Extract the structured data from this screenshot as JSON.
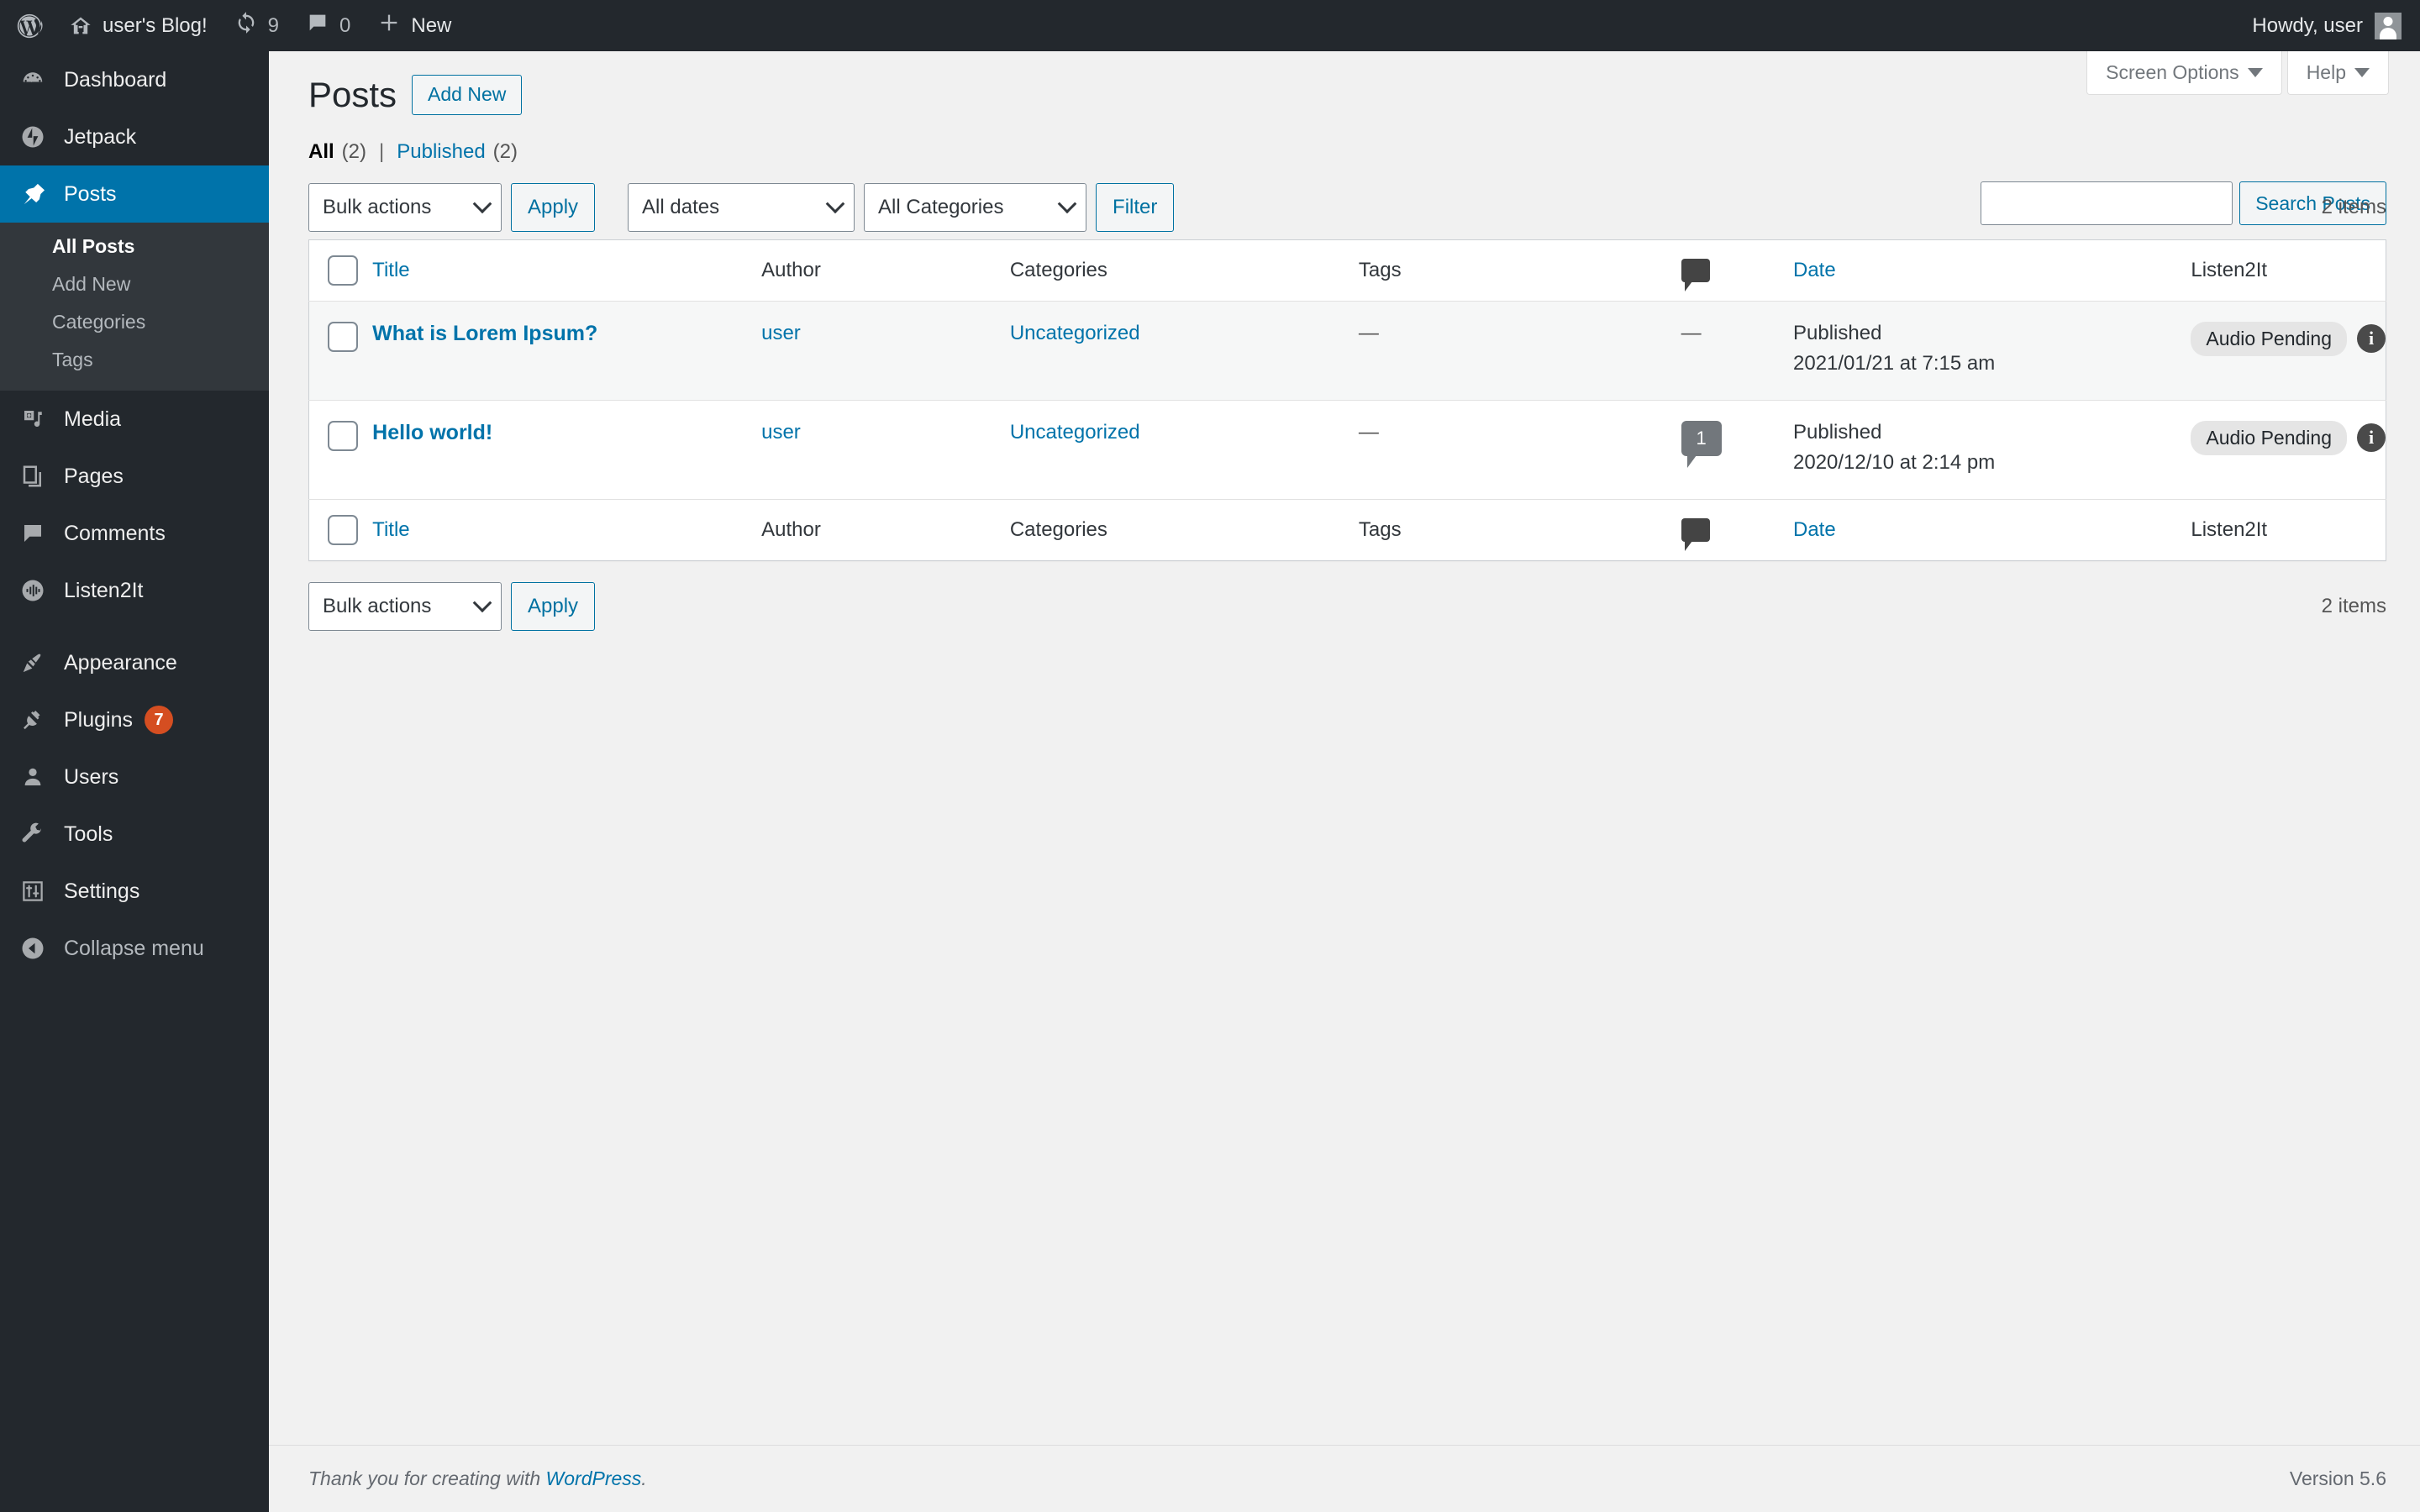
{
  "adminbar": {
    "logo_icon": "wordpress-logo-icon",
    "home_icon": "home-icon",
    "site_name": "user's Blog!",
    "updates_icon": "updates-icon",
    "updates_count": "9",
    "comments_icon": "comment-icon",
    "comments_count": "0",
    "new_icon": "plus-icon",
    "new_label": "New",
    "howdy": "Howdy, user",
    "avatar_icon": "avatar"
  },
  "sidebar": {
    "items": [
      {
        "label": "Dashboard",
        "icon": "dashboard-icon",
        "active": false
      },
      {
        "label": "Jetpack",
        "icon": "jetpack-icon",
        "active": false
      },
      {
        "label": "Posts",
        "icon": "pin-icon",
        "active": true
      },
      {
        "label": "Media",
        "icon": "media-icon",
        "active": false
      },
      {
        "label": "Pages",
        "icon": "pages-icon",
        "active": false
      },
      {
        "label": "Comments",
        "icon": "comments-icon",
        "active": false
      },
      {
        "label": "Listen2It",
        "icon": "listen2it-icon",
        "active": false
      },
      {
        "label": "Appearance",
        "icon": "appearance-icon",
        "active": false
      },
      {
        "label": "Plugins",
        "icon": "plugins-icon",
        "active": false,
        "badge": "7"
      },
      {
        "label": "Users",
        "icon": "users-icon",
        "active": false
      },
      {
        "label": "Tools",
        "icon": "tools-icon",
        "active": false
      },
      {
        "label": "Settings",
        "icon": "settings-icon",
        "active": false
      }
    ],
    "submenu": [
      {
        "label": "All Posts",
        "current": true
      },
      {
        "label": "Add New",
        "current": false
      },
      {
        "label": "Categories",
        "current": false
      },
      {
        "label": "Tags",
        "current": false
      }
    ],
    "collapse_label": "Collapse menu",
    "collapse_icon": "collapse-arrow-icon"
  },
  "screen_meta": {
    "screen_options": "Screen Options",
    "help": "Help"
  },
  "header": {
    "title": "Posts",
    "add_new": "Add New"
  },
  "views": {
    "all_label": "All",
    "all_count": "(2)",
    "separator": "|",
    "published_label": "Published",
    "published_count": "(2)"
  },
  "search": {
    "value": "",
    "placeholder": "",
    "button": "Search Posts"
  },
  "tablenav_top": {
    "bulk_actions": "Bulk actions",
    "apply": "Apply",
    "all_dates": "All dates",
    "all_categories": "All Categories",
    "filter": "Filter",
    "items_count": "2 items"
  },
  "tablenav_bottom": {
    "bulk_actions": "Bulk actions",
    "apply": "Apply",
    "items_count": "2 items"
  },
  "table": {
    "columns": {
      "title": "Title",
      "author": "Author",
      "categories": "Categories",
      "tags": "Tags",
      "comments_icon": "comment-icon",
      "date": "Date",
      "listen2it": "Listen2It"
    },
    "rows": [
      {
        "title": "What is Lorem Ipsum?",
        "author": "user",
        "categories": "Uncategorized",
        "tags": "—",
        "comments": "—",
        "comment_count": null,
        "date_status": "Published",
        "date_value": "2021/01/21 at 7:15 am",
        "listen2it_status": "Audio Pending",
        "info_icon": "info-icon"
      },
      {
        "title": "Hello world!",
        "author": "user",
        "categories": "Uncategorized",
        "tags": "—",
        "comments": "1",
        "comment_count": "1",
        "date_status": "Published",
        "date_value": "2020/12/10 at 2:14 pm",
        "listen2it_status": "Audio Pending",
        "info_icon": "info-icon"
      }
    ]
  },
  "footer": {
    "thanks_prefix": "Thank you for creating with ",
    "wordpress_link": "WordPress",
    "thanks_suffix": ".",
    "version": "Version 5.6"
  },
  "colors": {
    "admin_dark": "#23282d",
    "admin_submenu": "#32373c",
    "accent_blue": "#0073aa",
    "link_blue": "#0071a1",
    "badge_orange": "#d54e21",
    "page_bg": "#f1f1f1"
  }
}
